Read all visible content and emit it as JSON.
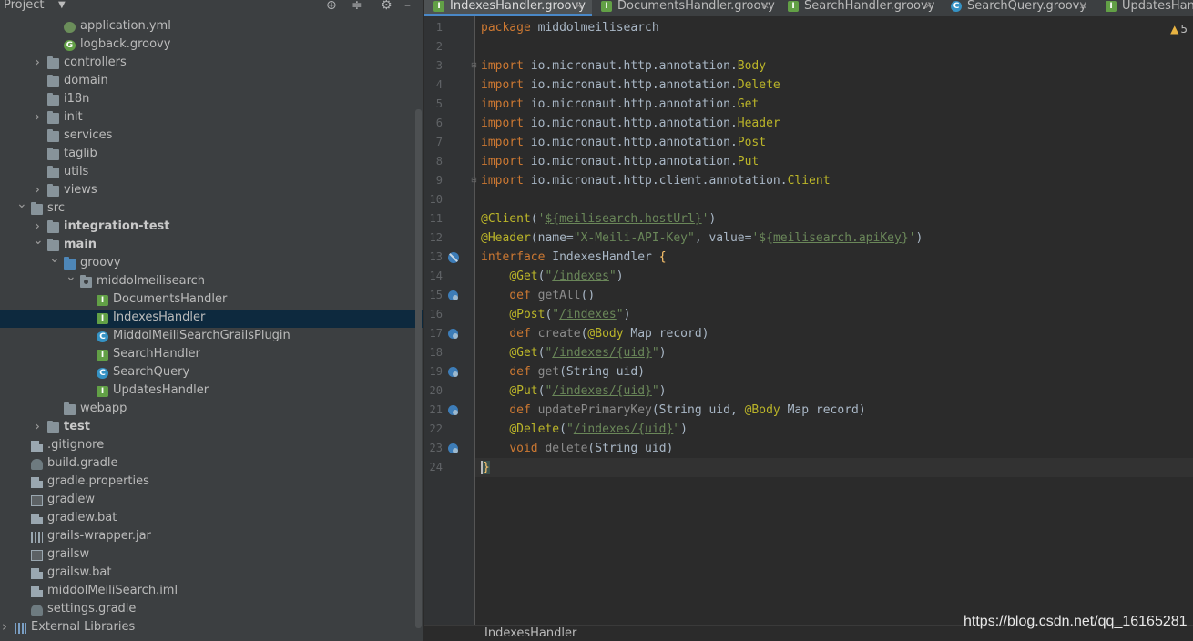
{
  "project_panel": {
    "title": "Project",
    "header_icons": [
      "crosshair-icon",
      "collapse-icon",
      "gear-icon",
      "hide-icon"
    ],
    "tree": [
      {
        "label": "application.yml",
        "icon": "leaf-icon",
        "depth": 3,
        "arrow": ""
      },
      {
        "label": "logback.groovy",
        "icon": "groovy-g-icon",
        "depth": 3,
        "arrow": ""
      },
      {
        "label": "controllers",
        "icon": "folder-icon",
        "depth": 2,
        "arrow": "right"
      },
      {
        "label": "domain",
        "icon": "folder-icon",
        "depth": 2,
        "arrow": ""
      },
      {
        "label": "i18n",
        "icon": "folder-icon",
        "depth": 2,
        "arrow": ""
      },
      {
        "label": "init",
        "icon": "folder-icon",
        "depth": 2,
        "arrow": "right"
      },
      {
        "label": "services",
        "icon": "folder-icon",
        "depth": 2,
        "arrow": ""
      },
      {
        "label": "taglib",
        "icon": "folder-icon",
        "depth": 2,
        "arrow": ""
      },
      {
        "label": "utils",
        "icon": "folder-icon",
        "depth": 2,
        "arrow": ""
      },
      {
        "label": "views",
        "icon": "folder-icon",
        "depth": 2,
        "arrow": "right"
      },
      {
        "label": "src",
        "icon": "folder-icon",
        "depth": 1,
        "arrow": "down"
      },
      {
        "label": "integration-test",
        "icon": "folder-icon",
        "depth": 2,
        "arrow": "right",
        "bold": true
      },
      {
        "label": "main",
        "icon": "folder-icon",
        "depth": 2,
        "arrow": "down",
        "bold": true
      },
      {
        "label": "groovy",
        "icon": "source-folder-icon",
        "depth": 3,
        "arrow": "down"
      },
      {
        "label": "middolmeilisearch",
        "icon": "package-icon",
        "depth": 4,
        "arrow": "down"
      },
      {
        "label": "DocumentsHandler",
        "icon": "interface-icon",
        "depth": 5,
        "arrow": ""
      },
      {
        "label": "IndexesHandler",
        "icon": "interface-icon",
        "depth": 5,
        "arrow": "",
        "selected": true
      },
      {
        "label": "MiddolMeiliSearchGrailsPlugin",
        "icon": "class-icon",
        "depth": 5,
        "arrow": ""
      },
      {
        "label": "SearchHandler",
        "icon": "interface-icon",
        "depth": 5,
        "arrow": ""
      },
      {
        "label": "SearchQuery",
        "icon": "class-icon",
        "depth": 5,
        "arrow": ""
      },
      {
        "label": "UpdatesHandler",
        "icon": "interface-icon",
        "depth": 5,
        "arrow": ""
      },
      {
        "label": "webapp",
        "icon": "folder-icon",
        "depth": 3,
        "arrow": ""
      },
      {
        "label": "test",
        "icon": "folder-icon",
        "depth": 2,
        "arrow": "right",
        "bold": true
      },
      {
        "label": ".gitignore",
        "icon": "file-icon",
        "depth": 1,
        "arrow": ""
      },
      {
        "label": "build.gradle",
        "icon": "gradle-icon",
        "depth": 1,
        "arrow": ""
      },
      {
        "label": "gradle.properties",
        "icon": "file-icon",
        "depth": 1,
        "arrow": ""
      },
      {
        "label": "gradlew",
        "icon": "terminal-icon",
        "depth": 1,
        "arrow": ""
      },
      {
        "label": "gradlew.bat",
        "icon": "file-icon",
        "depth": 1,
        "arrow": ""
      },
      {
        "label": "grails-wrapper.jar",
        "icon": "jar-icon",
        "depth": 1,
        "arrow": ""
      },
      {
        "label": "grailsw",
        "icon": "terminal-icon",
        "depth": 1,
        "arrow": ""
      },
      {
        "label": "grailsw.bat",
        "icon": "file-icon",
        "depth": 1,
        "arrow": ""
      },
      {
        "label": "middolMeiliSearch.iml",
        "icon": "module-file-icon",
        "depth": 1,
        "arrow": ""
      },
      {
        "label": "settings.gradle",
        "icon": "gradle-icon",
        "depth": 1,
        "arrow": ""
      },
      {
        "label": "External Libraries",
        "icon": "libraries-icon",
        "depth": 0,
        "arrow": "right"
      }
    ]
  },
  "editor": {
    "tabs": [
      {
        "label": "IndexesHandler.groovy",
        "icon": "interface-icon",
        "active": true
      },
      {
        "label": "DocumentsHandler.groovy",
        "icon": "interface-icon",
        "active": false
      },
      {
        "label": "SearchHandler.groovy",
        "icon": "interface-icon",
        "active": false
      },
      {
        "label": "SearchQuery.groovy",
        "icon": "class-icon",
        "active": false
      },
      {
        "label": "UpdatesHand",
        "icon": "interface-icon",
        "active": false
      }
    ],
    "warnings_count": "5",
    "breadcrumb": "IndexesHandler",
    "lines": [
      {
        "n": "1",
        "tokens": [
          [
            "kw",
            "package"
          ],
          [
            "",
            " middolmeilisearch"
          ]
        ]
      },
      {
        "n": "2",
        "tokens": []
      },
      {
        "n": "3",
        "fold": true,
        "tokens": [
          [
            "kw",
            "import"
          ],
          [
            "",
            " io.micronaut.http.annotation."
          ],
          [
            "ann",
            "Body"
          ]
        ]
      },
      {
        "n": "4",
        "tokens": [
          [
            "kw",
            "import"
          ],
          [
            "",
            " io.micronaut.http.annotation."
          ],
          [
            "ann",
            "Delete"
          ]
        ]
      },
      {
        "n": "5",
        "tokens": [
          [
            "kw",
            "import"
          ],
          [
            "",
            " io.micronaut.http.annotation."
          ],
          [
            "ann",
            "Get"
          ]
        ]
      },
      {
        "n": "6",
        "tokens": [
          [
            "kw",
            "import"
          ],
          [
            "",
            " io.micronaut.http.annotation."
          ],
          [
            "ann",
            "Header"
          ]
        ]
      },
      {
        "n": "7",
        "tokens": [
          [
            "kw",
            "import"
          ],
          [
            "",
            " io.micronaut.http.annotation."
          ],
          [
            "ann",
            "Post"
          ]
        ]
      },
      {
        "n": "8",
        "tokens": [
          [
            "kw",
            "import"
          ],
          [
            "",
            " io.micronaut.http.annotation."
          ],
          [
            "ann",
            "Put"
          ]
        ]
      },
      {
        "n": "9",
        "fold": true,
        "tokens": [
          [
            "kw",
            "import"
          ],
          [
            "",
            " io.micronaut.http.client.annotation."
          ],
          [
            "ann",
            "Client"
          ]
        ]
      },
      {
        "n": "10",
        "tokens": []
      },
      {
        "n": "11",
        "tokens": [
          [
            "ann",
            "@Client"
          ],
          [
            "",
            "("
          ],
          [
            "str",
            "'"
          ],
          [
            "str ul",
            "${meilisearch.hostUrl}"
          ],
          [
            "str",
            "'"
          ],
          [
            "",
            ")"
          ]
        ]
      },
      {
        "n": "12",
        "tokens": [
          [
            "ann",
            "@Header"
          ],
          [
            "",
            "(name="
          ],
          [
            "str",
            "\"X-Meili-API-Key\""
          ],
          [
            "",
            ", value="
          ],
          [
            "str",
            "'${"
          ],
          [
            "str ul",
            "meilisearch.apiKey"
          ],
          [
            "str",
            "}'"
          ],
          [
            "",
            ")"
          ]
        ]
      },
      {
        "n": "13",
        "gutter": "no-impl",
        "tokens": [
          [
            "kw",
            "interface"
          ],
          [
            "",
            " IndexesHandler "
          ],
          [
            "meth",
            "{"
          ]
        ]
      },
      {
        "n": "14",
        "tokens": [
          [
            "",
            "    "
          ],
          [
            "ann",
            "@Get"
          ],
          [
            "",
            "("
          ],
          [
            "str",
            "\""
          ],
          [
            "str ul",
            "/indexes"
          ],
          [
            "str",
            "\""
          ],
          [
            "",
            ")"
          ]
        ]
      },
      {
        "n": "15",
        "gutter": "impl",
        "tokens": [
          [
            "",
            "    "
          ],
          [
            "kw",
            "def"
          ],
          [
            "dim",
            " getAll"
          ],
          [
            "",
            "()"
          ]
        ]
      },
      {
        "n": "16",
        "tokens": [
          [
            "",
            "    "
          ],
          [
            "ann",
            "@Post"
          ],
          [
            "",
            "("
          ],
          [
            "str",
            "\""
          ],
          [
            "str ul",
            "/indexes"
          ],
          [
            "str",
            "\""
          ],
          [
            "",
            ")"
          ]
        ]
      },
      {
        "n": "17",
        "gutter": "impl",
        "tokens": [
          [
            "",
            "    "
          ],
          [
            "kw",
            "def"
          ],
          [
            "dim",
            " create"
          ],
          [
            "",
            "("
          ],
          [
            "ann",
            "@Body"
          ],
          [
            "",
            " Map record)"
          ]
        ]
      },
      {
        "n": "18",
        "tokens": [
          [
            "",
            "    "
          ],
          [
            "ann",
            "@Get"
          ],
          [
            "",
            "("
          ],
          [
            "str",
            "\""
          ],
          [
            "str ul",
            "/indexes/{uid}"
          ],
          [
            "str",
            "\""
          ],
          [
            "",
            ")"
          ]
        ]
      },
      {
        "n": "19",
        "gutter": "impl",
        "tokens": [
          [
            "",
            "    "
          ],
          [
            "kw",
            "def"
          ],
          [
            "dim",
            " get"
          ],
          [
            "",
            "(String uid)"
          ]
        ]
      },
      {
        "n": "20",
        "tokens": [
          [
            "",
            "    "
          ],
          [
            "ann",
            "@Put"
          ],
          [
            "",
            "("
          ],
          [
            "str",
            "\""
          ],
          [
            "str ul",
            "/indexes/{uid}"
          ],
          [
            "str",
            "\""
          ],
          [
            "",
            ")"
          ]
        ]
      },
      {
        "n": "21",
        "gutter": "impl",
        "tokens": [
          [
            "",
            "    "
          ],
          [
            "kw",
            "def"
          ],
          [
            "dim",
            " updatePrimaryKey"
          ],
          [
            "",
            "(String uid, "
          ],
          [
            "ann",
            "@Body"
          ],
          [
            "",
            " Map record)"
          ]
        ]
      },
      {
        "n": "22",
        "tokens": [
          [
            "",
            "    "
          ],
          [
            "ann",
            "@Delete"
          ],
          [
            "",
            "("
          ],
          [
            "str",
            "\""
          ],
          [
            "str ul",
            "/indexes/{uid}"
          ],
          [
            "str",
            "\""
          ],
          [
            "",
            ")"
          ]
        ]
      },
      {
        "n": "23",
        "gutter": "impl",
        "tokens": [
          [
            "",
            "    "
          ],
          [
            "kw",
            "void"
          ],
          [
            "dim",
            " delete"
          ],
          [
            "",
            "(String uid)"
          ]
        ]
      },
      {
        "n": "24",
        "current": true,
        "tokens": [
          [
            "meth caret",
            "}"
          ]
        ]
      }
    ]
  },
  "watermark": "https://blog.csdn.net/qq_16165281"
}
